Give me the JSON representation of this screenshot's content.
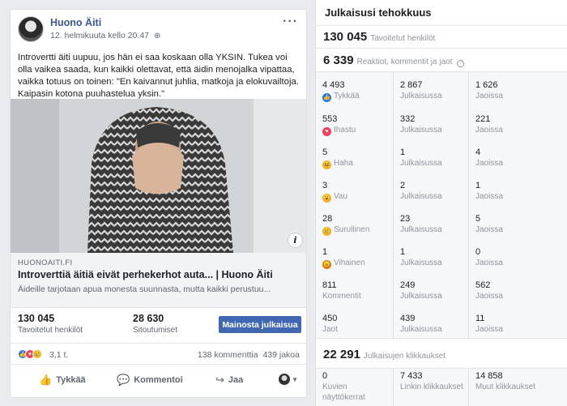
{
  "post": {
    "page_name": "Huono Äiti",
    "date": "12. helmikuuta kello 20.47",
    "body_text": "Introvertti äiti uupuu, jos hän ei saa koskaan olla YKSIN. Tukea voi olla vaikea saada, kun kaikki olettavat, että äidin menojalka vipattaa, vaikka totuus on toinen: \"En kaivannut juhlia, matkoja ja elokuvailtoja. Kaipasin kotona puuhastelua yksin.\"",
    "link": {
      "domain": "HUONOAITI.FI",
      "title": "Introverttiä äitiä eivät perhekerhot auta... | Huono Äiti",
      "description": "Äideille tarjotaan apua monesta suunnasta, mutta kaikki perustuu..."
    },
    "reach": {
      "value": "130 045",
      "label": "Tavoitetut henkilöt"
    },
    "engagement": {
      "value": "28 630",
      "label": "Sitoutumiset"
    },
    "promote_label": "Mainosta julkaisua",
    "reactions_count": "3,1 t.",
    "comments": "138 kommenttia",
    "shares": "439 jakoa",
    "actions": {
      "like": "Tykkää",
      "comment": "Kommentoi",
      "share": "Jaa"
    }
  },
  "insights": {
    "title": "Julkaisusi tehokkuus",
    "reached": {
      "value": "130 045",
      "label": "Tavoitetut henkilöt"
    },
    "reactions_total": {
      "value": "6 339",
      "label": "Reaktiot, kommentit ja jaot"
    },
    "rows": [
      {
        "icon": "like",
        "color": "#2078f4",
        "glyph": "👍",
        "c1_num": "4 493",
        "c1_lbl": "Tykkää",
        "c2_num": "2 867",
        "c2_lbl": "Julkaisussa",
        "c3_num": "1 626",
        "c3_lbl": "Jaoissa"
      },
      {
        "icon": "love",
        "color": "#f33e58",
        "glyph": "♥",
        "c1_num": "553",
        "c1_lbl": "Ihastu",
        "c2_num": "332",
        "c2_lbl": "Julkaisussa",
        "c3_num": "221",
        "c3_lbl": "Jaoissa"
      },
      {
        "icon": "haha",
        "color": "#f7b125",
        "glyph": "😆",
        "c1_num": "5",
        "c1_lbl": "Haha",
        "c2_num": "1",
        "c2_lbl": "Julkaisussa",
        "c3_num": "4",
        "c3_lbl": "Jaoissa"
      },
      {
        "icon": "wow",
        "color": "#f7b125",
        "glyph": "😮",
        "c1_num": "3",
        "c1_lbl": "Vau",
        "c2_num": "2",
        "c2_lbl": "Julkaisussa",
        "c3_num": "1",
        "c3_lbl": "Jaoissa"
      },
      {
        "icon": "sad",
        "color": "#f7b125",
        "glyph": "😢",
        "c1_num": "28",
        "c1_lbl": "Surullinen",
        "c2_num": "23",
        "c2_lbl": "Julkaisussa",
        "c3_num": "5",
        "c3_lbl": "Jaoissa"
      },
      {
        "icon": "angry",
        "color": "#e9710f",
        "glyph": "😠",
        "c1_num": "1",
        "c1_lbl": "Vihainen",
        "c2_num": "1",
        "c2_lbl": "Julkaisussa",
        "c3_num": "0",
        "c3_lbl": "Jaoissa"
      },
      {
        "icon": "",
        "color": "",
        "glyph": "",
        "c1_num": "811",
        "c1_lbl": "Kommentit",
        "c2_num": "249",
        "c2_lbl": "Julkaisussa",
        "c3_num": "562",
        "c3_lbl": "Jaoissa"
      },
      {
        "icon": "",
        "color": "",
        "glyph": "",
        "c1_num": "450",
        "c1_lbl": "Jaot",
        "c2_num": "439",
        "c2_lbl": "Julkaisussa",
        "c3_num": "11",
        "c3_lbl": "Jaoissa"
      }
    ],
    "clicks_total": {
      "value": "22 291",
      "label": "Julkaisujen klikkaukset"
    },
    "clicks": [
      {
        "num": "0",
        "lbl": "Kuvien näyttökerrat"
      },
      {
        "num": "7 433",
        "lbl": "Linkin klikkaukset"
      },
      {
        "num": "14 858",
        "lbl": "Muut klikkaukset"
      }
    ]
  }
}
